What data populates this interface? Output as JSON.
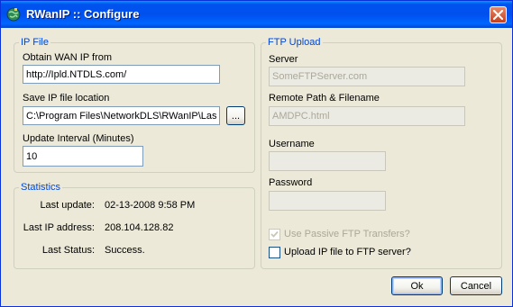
{
  "window": {
    "title": "RWanIP :: Configure",
    "icon": "globe-icon",
    "close_icon": "close-icon"
  },
  "ip_file": {
    "legend": "IP File",
    "wan_label": "Obtain WAN IP from",
    "wan_value": "http://Ipld.NTDLS.com/",
    "save_label": "Save IP file location",
    "save_value": "C:\\Program Files\\NetworkDLS\\RWanIP\\Last.txt",
    "browse_label": "...",
    "interval_label": "Update Interval (Minutes)",
    "interval_value": "10"
  },
  "statistics": {
    "legend": "Statistics",
    "rows": [
      {
        "label": "Last update:",
        "value": "02-13-2008 9:58 PM"
      },
      {
        "label": "Last IP address:",
        "value": "208.104.128.82"
      },
      {
        "label": "Last Status:",
        "value": "Success."
      }
    ]
  },
  "ftp": {
    "legend": "FTP Upload",
    "server_label": "Server",
    "server_value": "SomeFTPServer.com",
    "path_label": "Remote Path & Filename",
    "path_value": "AMDPC.html",
    "username_label": "Username",
    "username_value": "",
    "password_label": "Password",
    "password_value": "",
    "passive_label": "Use Passive FTP Transfers?",
    "passive_checked": true,
    "upload_label": "Upload IP file to FTP server?",
    "upload_checked": false
  },
  "buttons": {
    "ok": "Ok",
    "cancel": "Cancel"
  }
}
